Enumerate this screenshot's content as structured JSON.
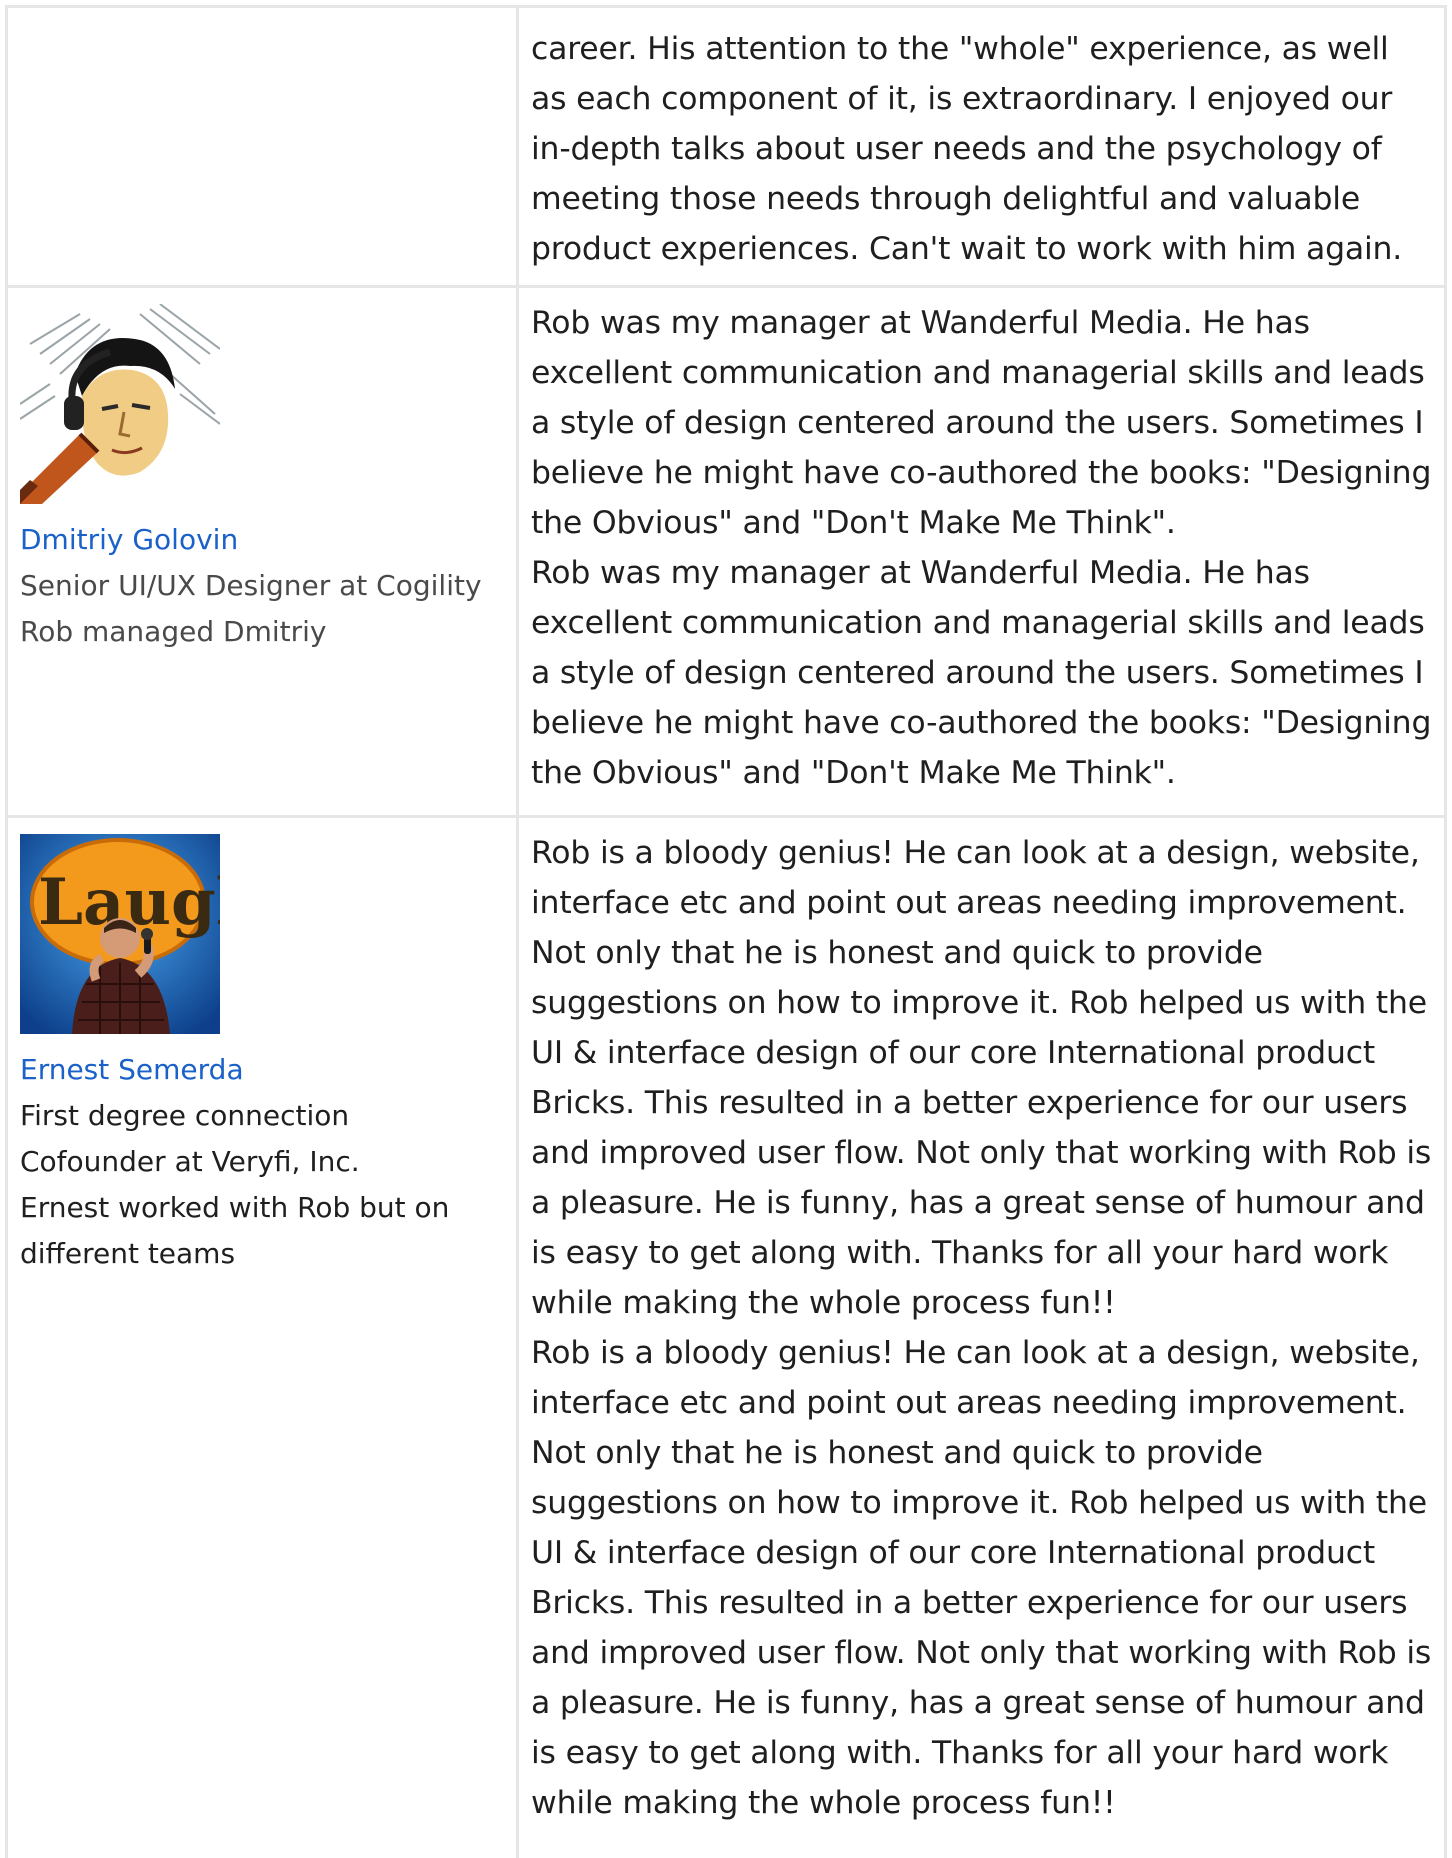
{
  "recommendations": [
    {
      "text": [
        "career. His attention to the \"whole\" experience, as well as each component of it, is extraordinary. I enjoyed our in-depth talks about user needs and the psychology of meeting those needs through delightful and valuable product experiences. Can't wait to work with him again."
      ]
    },
    {
      "name": "Dmitriy Golovin",
      "headline": "Senior UI/UX Designer at Cogility",
      "relationship": "Rob managed Dmitriy",
      "text": [
        "Rob was my manager at Wanderful Media. He has excellent communication and managerial skills and leads a style of design centered around the users. Sometimes I believe he might have co-authored the books: \"Designing the Obvious\" and \"Don't Make Me Think\".",
        "Rob was my manager at Wanderful Media. He has excellent communication and managerial skills and leads a style of design centered around the users. Sometimes I believe he might have co-authored the books: \"Designing the Obvious\" and \"Don't Make Me Think\"."
      ]
    },
    {
      "name": "Ernest Semerda",
      "degree": "First degree connection",
      "headline": "Cofounder at Veryfi, Inc.",
      "relationship": "Ernest worked with Rob but on different teams",
      "text": [
        "Rob is a bloody genius! He can look at a design, website, interface etc and point out areas needing improvement. Not only that he is honest and quick to provide suggestions on how to improve it. Rob helped us with the UI & interface design of our core International product Bricks. This resulted in a better experience for our users and improved user flow. Not only that working with Rob is a pleasure. He is funny, has a great sense of humour and is easy to get along with. Thanks for all your hard work while making the whole process fun!!",
        "Rob is a bloody genius! He can look at a design, website, interface etc and point out areas needing improvement. Not only that he is honest and quick to provide suggestions on how to improve it. Rob helped us with the UI & interface design of our core International product Bricks. This resulted in a better experience for our users and improved user flow. Not only that working with Rob is a pleasure. He is funny, has a great sense of humour and is easy to get along with. Thanks for all your hard work while making the whole process fun!!"
      ]
    }
  ],
  "avatar_logo_text": "Laugh",
  "colors": {
    "link": "#1a61c9",
    "border": "#e6e6e6",
    "meta_text": "#4a4a4a",
    "body_text": "#1f1f1f"
  }
}
